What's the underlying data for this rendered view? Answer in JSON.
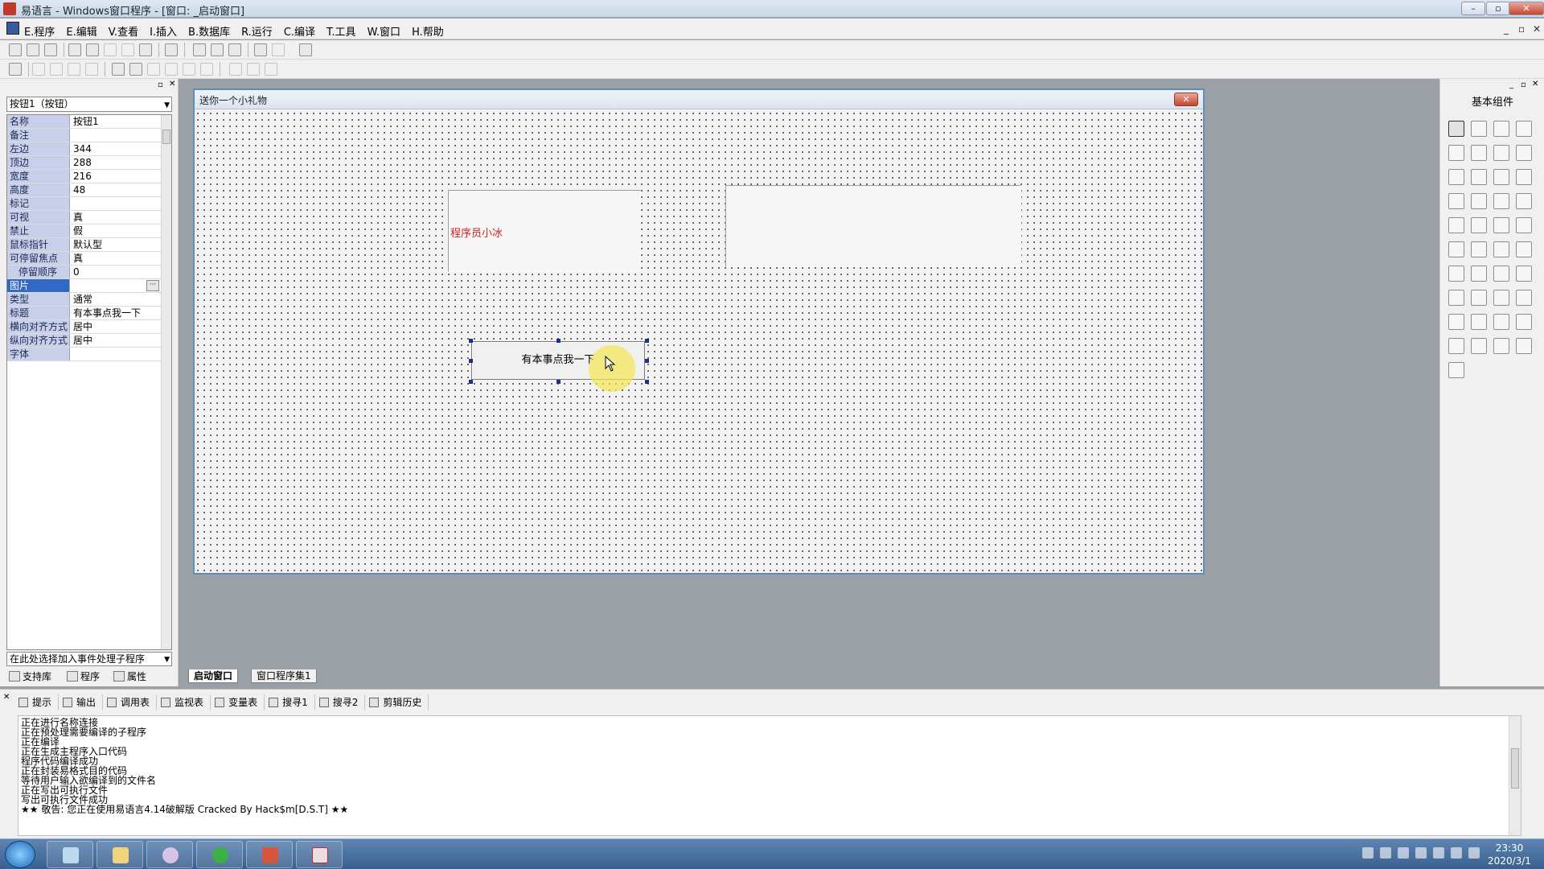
{
  "window": {
    "title": "易语言 - Windows窗口程序 - [窗口: _启动窗口]"
  },
  "menu": {
    "items": [
      "E.程序",
      "E.编辑",
      "V.查看",
      "I.插入",
      "B.数据库",
      "R.运行",
      "C.编译",
      "T.工具",
      "W.窗口",
      "H.帮助"
    ]
  },
  "object_selector": {
    "value": "按钮1（按钮）"
  },
  "properties": [
    {
      "name": "名称",
      "value": "按钮1"
    },
    {
      "name": "备注",
      "value": ""
    },
    {
      "name": "左边",
      "value": "344"
    },
    {
      "name": "顶边",
      "value": "288"
    },
    {
      "name": "宽度",
      "value": "216"
    },
    {
      "name": "高度",
      "value": "48"
    },
    {
      "name": "标记",
      "value": ""
    },
    {
      "name": "可视",
      "value": "真"
    },
    {
      "name": "禁止",
      "value": "假"
    },
    {
      "name": "鼠标指针",
      "value": "默认型"
    },
    {
      "name": "可停留焦点",
      "value": "真"
    },
    {
      "name": "停留顺序",
      "value": "0"
    },
    {
      "name": "图片",
      "value": "",
      "selected": true
    },
    {
      "name": "类型",
      "value": "通常"
    },
    {
      "name": "标题",
      "value": "有本事点我一下"
    },
    {
      "name": "横向对齐方式",
      "value": "居中"
    },
    {
      "name": "纵向对齐方式",
      "value": "居中"
    },
    {
      "name": "字体",
      "value": ""
    }
  ],
  "event_selector": {
    "placeholder": "在此处选择加入事件处理子程序"
  },
  "left_tabs": [
    "支持库",
    "程序",
    "属性"
  ],
  "form": {
    "title": "送你一个小礼物",
    "label_text": "程序员小冰",
    "button_text": "有本事点我一下"
  },
  "editor_tabs": [
    "启动窗口",
    "窗口程序集1"
  ],
  "toolbox": {
    "title": "基本组件"
  },
  "output_tabs": [
    "提示",
    "输出",
    "调用表",
    "监视表",
    "变量表",
    "搜寻1",
    "搜寻2",
    "剪辑历史"
  ],
  "output_lines": [
    "正在进行名称连接",
    "正在预处理需要编译的子程序",
    "正在编译",
    "正在生成主程序入口代码",
    "程序代码编译成功",
    "正在封装易格式目的代码",
    "等待用户输入欲编译到的文件名",
    "正在写出可执行文件",
    "写出可执行文件成功",
    "★★ 敬告: 您正在使用易语言4.14破解版  Cracked By Hack$m[D.S.T] ★★"
  ],
  "taskbar": {
    "time": "23:30",
    "date": "2020/3/1"
  }
}
